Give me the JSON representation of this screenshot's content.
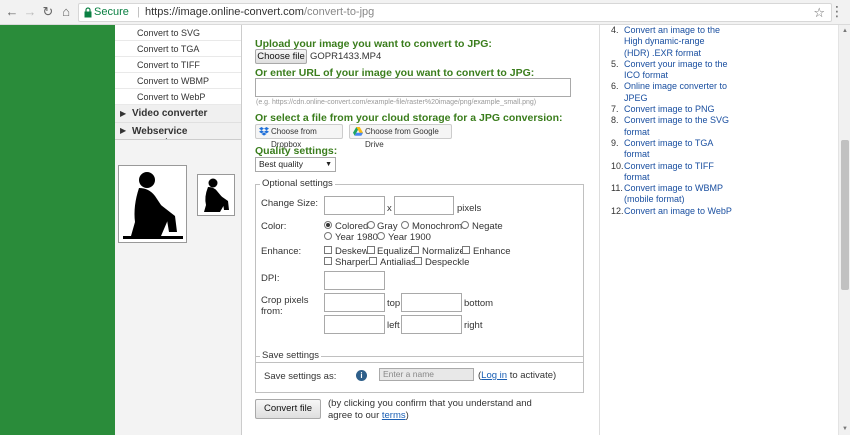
{
  "browser": {
    "secure_label": "Secure",
    "url_host": "https://image.online-convert.com",
    "url_path": "/convert-to-jpg"
  },
  "sidebar": {
    "sub_items": [
      "Convert to SVG",
      "Convert to TGA",
      "Convert to TIFF",
      "Convert to WBMP",
      "Convert to WebP"
    ],
    "categories": [
      "Video converter",
      "Webservice converter"
    ]
  },
  "upload": {
    "heading": "Upload your image you want to convert to JPG:",
    "choose_file_label": "Choose file",
    "file_name": "GOPR1433.MP4",
    "url_heading": "Or enter URL of your image you want to convert to JPG:",
    "url_value": "",
    "url_example": "(e.g. https://cdn.online-convert.com/example-file/raster%20image/png/example_small.png)",
    "cloud_heading": "Or select a file from your cloud storage for a JPG conversion:",
    "dropbox_label": "Choose from Dropbox",
    "gdrive_label": "Choose from Google Drive"
  },
  "quality": {
    "heading": "Quality settings:",
    "selected": "Best quality"
  },
  "optional": {
    "legend": "Optional settings",
    "change_size_label": "Change Size:",
    "x_label": "x",
    "pixels_label": "pixels",
    "color_label": "Color:",
    "color_options": [
      "Colored",
      "Gray",
      "Monochrome",
      "Negate",
      "Year 1980",
      "Year 1900"
    ],
    "color_selected": "Colored",
    "enhance_label": "Enhance:",
    "enhance_options": [
      "Deskew",
      "Equalize",
      "Normalize",
      "Enhance",
      "Sharpen",
      "Antialias",
      "Despeckle"
    ],
    "dpi_label": "DPI:",
    "crop_label": "Crop pixels",
    "crop_label_2": "from:",
    "top_label": "top",
    "bottom_label": "bottom",
    "left_label": "left",
    "right_label": "right"
  },
  "save": {
    "legend": "Save settings",
    "label": "Save settings as:",
    "placeholder": "Enter a name",
    "login_prefix": "(",
    "login_link": "Log in",
    "login_suffix": " to activate)"
  },
  "convert": {
    "button_label": "Convert file",
    "note_1": "(by clicking you confirm that you understand and",
    "note_2_prefix": "agree to our ",
    "terms_link": "terms",
    "note_2_suffix": ")"
  },
  "right_list": {
    "items": [
      {
        "num": "4.",
        "text": "Convert an image to the High dynamic-range (HDR) .EXR format"
      },
      {
        "num": "5.",
        "text": "Convert your image to the ICO format"
      },
      {
        "num": "6.",
        "text": "Online image converter to JPEG"
      },
      {
        "num": "7.",
        "text": "Convert image to PNG"
      },
      {
        "num": "8.",
        "text": "Convert image to the SVG format"
      },
      {
        "num": "9.",
        "text": "Convert image to TGA format"
      },
      {
        "num": "10.",
        "text": "Convert image to TIFF format"
      },
      {
        "num": "11.",
        "text": "Convert image to WBMP (mobile format)"
      },
      {
        "num": "12.",
        "text": "Convert an image to WebP"
      }
    ]
  }
}
